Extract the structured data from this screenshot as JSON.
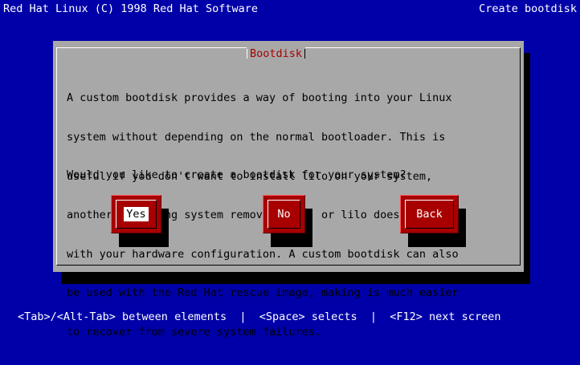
{
  "header": {
    "left_title": "Red Hat Linux (C) 1998 Red Hat Software",
    "right_title": "Create bootdisk"
  },
  "dialog": {
    "title": "Bootdisk",
    "body_lines": [
      "A custom bootdisk provides a way of booting into your Linux",
      "system without depending on the normal bootloader. This is",
      "useful if you don't want to install lilo on your system,",
      "another operating system removes lilo, or lilo doesn't work",
      "with your hardware configuration. A custom bootdisk can also",
      "be used with the Red Hat rescue image, making is much easier",
      "to recover from severe system failures."
    ],
    "question": "Would you like to create a bootdisk for your system?",
    "buttons": {
      "yes": "Yes",
      "no": "No",
      "back": "Back"
    }
  },
  "statusbar": {
    "text": "<Tab>/<Alt-Tab> between elements  |  <Space> selects  |  <F12> next screen"
  },
  "colors": {
    "background": "#0000a8",
    "dialog": "#a8a8a8",
    "button": "#a80000",
    "title_text": "#a80000"
  }
}
